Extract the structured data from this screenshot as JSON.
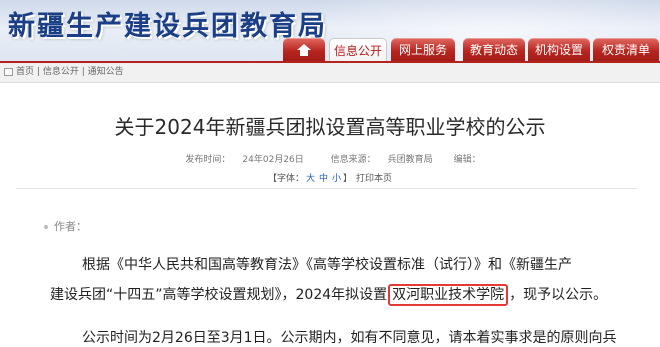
{
  "header": {
    "site_title": "新疆生产建设兵团教育局",
    "nav": [
      {
        "label": "",
        "icon": "home-icon"
      },
      {
        "label": "信息公开",
        "active": true
      },
      {
        "label": "网上服务"
      },
      {
        "label": "教育动态"
      },
      {
        "label": "机构设置"
      },
      {
        "label": "权责清单"
      }
    ]
  },
  "breadcrumb": {
    "items": [
      "首页",
      "信息公开",
      "通知公告"
    ],
    "separator": "|"
  },
  "article": {
    "title": "关于2024年新疆兵团拟设置高等职业学校的公示",
    "publish_label": "发布时间：",
    "publish_date": "24年02月26日",
    "source_label": "信息来源：",
    "source": "兵团教育局",
    "editor_label": "编辑：",
    "font_label": "【字体：",
    "font_large": "大",
    "font_medium": "中",
    "font_small": "小",
    "font_close": "】",
    "print": "打印本页",
    "author_label": "作者：",
    "p1": "根据《中华人民共和国高等教育法》《高等学校设置标准（试行）》和《新疆生产",
    "p2_before": "建设兵团“十四五”高等学校设置规划》，2024年拟设置",
    "p2_highlight": "双河职业技术学院",
    "p2_after": "，现予以公示。",
    "p3": "公示时间为2月26日至3月1日。公示期内，如有不同意见，请本着实事求是的原则向兵"
  },
  "colors": {
    "brand_blue": "#1b3f86",
    "nav_red": "#b8251f",
    "highlight_border": "#e53935"
  }
}
